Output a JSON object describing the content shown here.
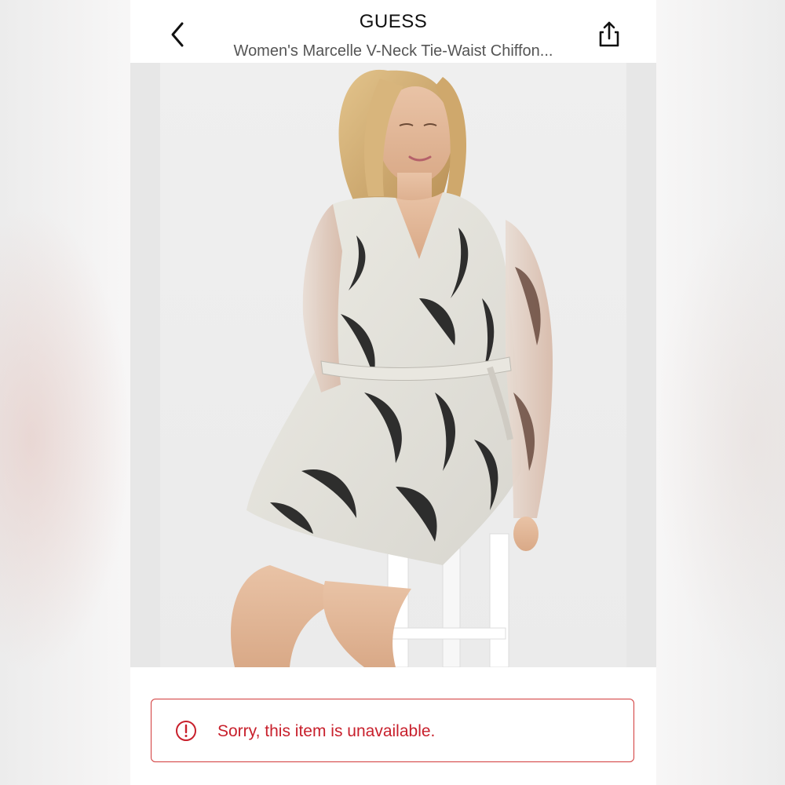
{
  "header": {
    "brand": "GUESS",
    "product_title": "Women's Marcelle V-Neck Tie-Waist Chiffon...",
    "back_icon": "chevron-left-icon",
    "share_icon": "share-icon"
  },
  "product_image": {
    "description_icon": "product-photo"
  },
  "availability": {
    "message": "Sorry, this item is unavailable.",
    "icon": "alert-circle-icon",
    "accent_color": "#d23a3a"
  }
}
